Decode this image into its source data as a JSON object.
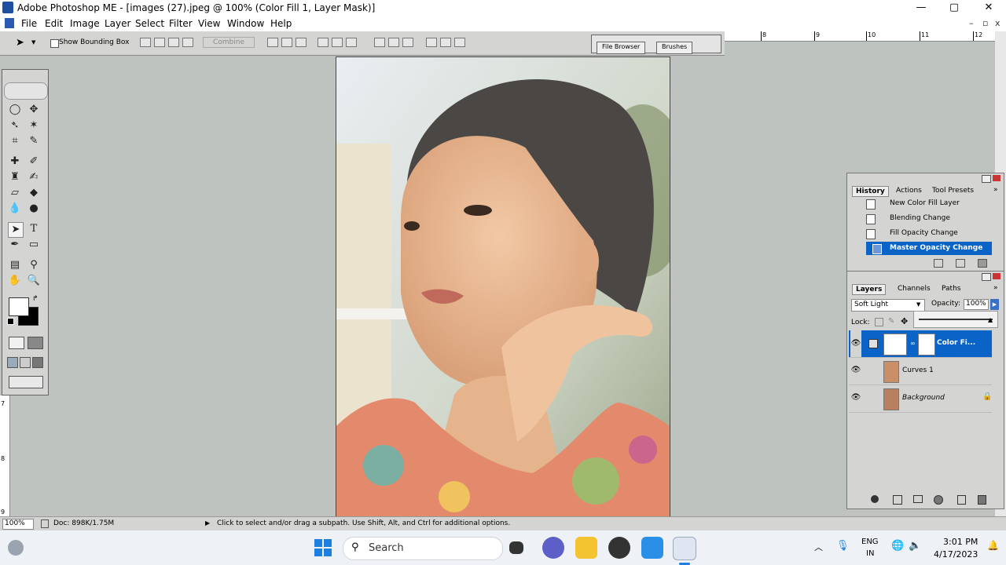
{
  "window": {
    "title": "Adobe Photoshop ME - [images (27).jpeg @ 100% (Color Fill 1, Layer Mask)]",
    "minimize": "—",
    "maximize": "▢",
    "close": "✕"
  },
  "menu": [
    "File",
    "Edit",
    "Image",
    "Layer",
    "Select",
    "Filter",
    "View",
    "Window",
    "Help"
  ],
  "mdi": {
    "minimize": "–",
    "restore": "▫",
    "close": "x"
  },
  "options": {
    "show_bounding_box": "Show Bounding Box",
    "combine": "Combine"
  },
  "well_tabs": [
    "File Browser",
    "Brushes"
  ],
  "ruler": {
    "marks": [
      "8",
      "9",
      "10",
      "11",
      "12"
    ]
  },
  "vruler": {
    "marks": [
      "7",
      "8",
      "9"
    ]
  },
  "history": {
    "tabs": [
      "History",
      "Actions",
      "Tool Presets"
    ],
    "items": [
      "New Color Fill Layer",
      "Blending Change",
      "Fill Opacity Change",
      "Master Opacity Change"
    ],
    "selected_index": 3
  },
  "layers": {
    "tabs": [
      "Layers",
      "Channels",
      "Paths"
    ],
    "blend_mode": "Soft Light",
    "opacity_label": "Opacity:",
    "opacity_value": "100%",
    "lock_label": "Lock:",
    "items": [
      {
        "name": "Color Fi..."
      },
      {
        "name": "Curves 1"
      },
      {
        "name": "Background"
      }
    ]
  },
  "status": {
    "zoom": "100%",
    "doc": "Doc: 898K/1.75M",
    "hint": "Click to select and/or drag a subpath. Use Shift, Alt, and Ctrl for additional options."
  },
  "taskbar": {
    "search": "Search",
    "lang_top": "ENG",
    "lang_bottom": "IN",
    "time": "3:01 PM",
    "date": "4/17/2023"
  },
  "colors": {
    "accent": "#0a64c8",
    "selection": "#0a64c8",
    "panel": "#d4d5d3",
    "workspace": "#bfc3c0"
  }
}
